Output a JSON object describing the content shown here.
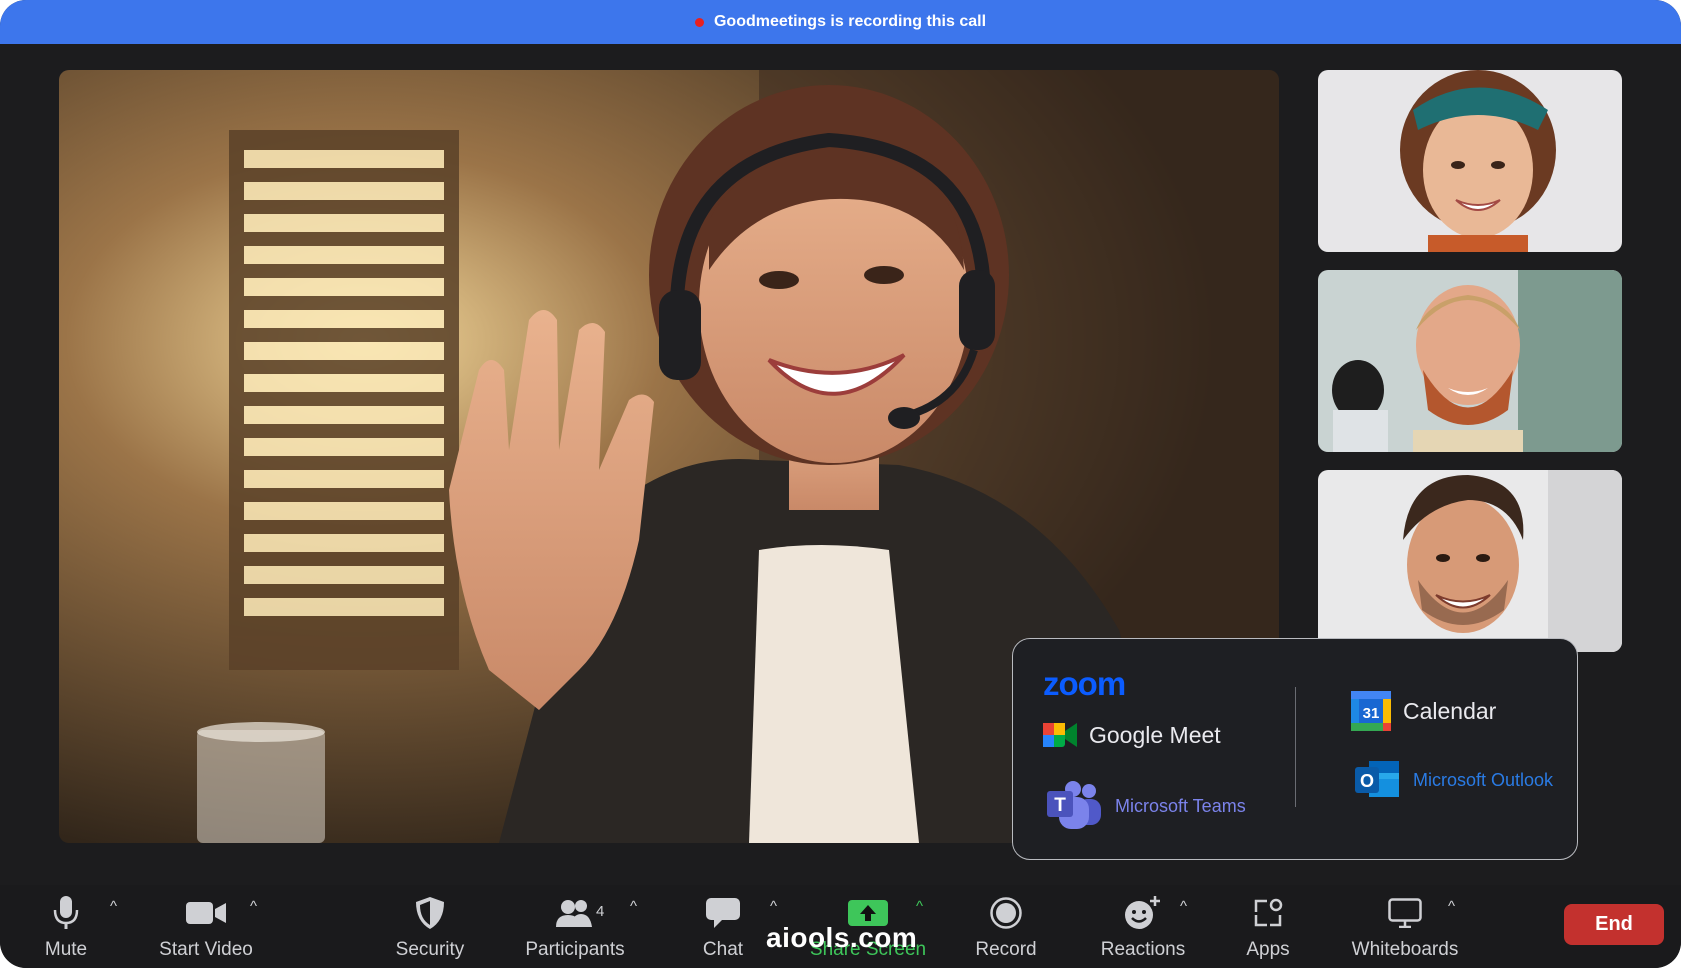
{
  "banner": {
    "text": "Goodmeetings is recording this call",
    "dot_color": "#e8201f"
  },
  "participants": {
    "main": "smiling woman with headset waving",
    "thumbnails": [
      "curly-haired woman with green headband",
      "bearded man smiling",
      "man with dark hair smiling"
    ]
  },
  "integrations": {
    "zoom_label": "zoom",
    "left": [
      {
        "name": "Google Meet",
        "icon": "google-meet-icon"
      },
      {
        "name": "Microsoft Teams",
        "icon": "teams-icon"
      }
    ],
    "right": [
      {
        "name": "Calendar",
        "icon": "calendar-icon",
        "day": "31"
      },
      {
        "name": "Microsoft Outlook",
        "icon": "outlook-icon"
      }
    ]
  },
  "toolbar": {
    "mute": "Mute",
    "start_video": "Start Video",
    "security": "Security",
    "participants": "Participants",
    "participants_count": "4",
    "chat": "Chat",
    "share_screen": "Share Screen",
    "record": "Record",
    "reactions": "Reactions",
    "apps": "Apps",
    "whiteboards": "Whiteboards",
    "end": "End",
    "caret": "^"
  },
  "watermark": "aiools.com",
  "colors": {
    "banner": "#3d76ec",
    "share_green": "#3ec65a",
    "end_red": "#c3312e",
    "zoom_blue": "#0b5cff",
    "ms_blue": "#2a7be4",
    "teams_purple": "#7b83eb"
  }
}
